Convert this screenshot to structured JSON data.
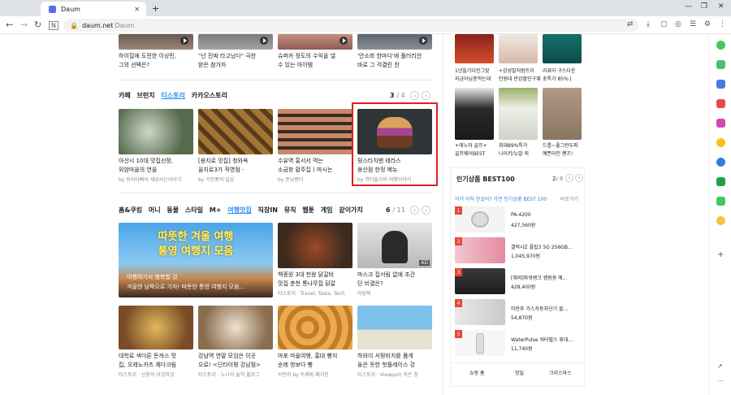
{
  "browser": {
    "tab_title": "Daum",
    "url": "daum.net",
    "url_suffix": "Daum"
  },
  "top_strip": [
    {
      "title": "하이힐에 도전한 이상민,",
      "title2": "그의 선택은?"
    },
    {
      "title": "\"넌 진짜 타고났다\" 극찬",
      "title2": "받은 참가자"
    },
    {
      "title": "슈퍼카 정도의 수익을 낼",
      "title2": "수 있는 아이템"
    },
    {
      "title": "'안소희 한마디'에 플러리안",
      "title2": "바로 그 걱결린 찬"
    }
  ],
  "section1": {
    "tabs": [
      "카페",
      "브런치",
      "티스토리",
      "카카오스토리"
    ],
    "active_tab": "티스토리",
    "page": "3",
    "total": "/ 4",
    "cards": [
      {
        "title": "아산시 10대 맛집선정,",
        "title2": "외암마을의 연을",
        "source": "by 동지아빠의 세상사는이야기"
      },
      {
        "title": "[용지로 맛집] 청와옥",
        "title2": "을지로3가 직영점 -",
        "source": "by 기린뽀의 일상"
      },
      {
        "title": "수유역 홍서서 먹는",
        "title2": "소금창 황주집 ( 마시는",
        "source": "by 준닝랜더"
      },
      {
        "title": "핑스타치맨 테라스",
        "title2": "용산점 한정 메뉴",
        "source": "by 히티들리의 여행이야기"
      }
    ]
  },
  "section2": {
    "tabs": [
      "홈&쿠킹",
      "머니",
      "동물",
      "스타일",
      "M+",
      "여행맛집",
      "직장IN",
      "뮤직",
      "웹툰",
      "게임",
      "같이가치"
    ],
    "active_tab": "여행맛집",
    "page": "6",
    "total": "/ 11",
    "hero": {
      "line1": "따뜻한 겨울 여행",
      "line2": "통영 여행지 모음",
      "caption1": "여행여기서 행복할 것",
      "caption2": "겨울엔 남쪽으로 가자! 따뜻한 통영 여행지 모음..."
    },
    "cards": [
      {
        "title": "백종원 3대 천왕 닭갈비",
        "title2": "맛집 춘천 통나무집 닭갈",
        "source": "티스토리 · Travel, Taste, Tech"
      },
      {
        "title": "마스크 집서림 없애 조간",
        "title2": "단 비결은?",
        "source": "리빙픽",
        "tag": "AD"
      },
      {
        "title": "대학로 색다른 돈까스 맛",
        "title2": "집, 오레노카츠 체다크림",
        "source": "티스토리 · 신웅의 이것저것"
      },
      {
        "title": "강남역 연말 모임은 이곳",
        "title2": "으로! <딘타이펑 강남점>",
        "source": "티스토리 · 노나의 술직 블로그"
      },
      {
        "title": "마포 마을여행, 홍대 빵지",
        "title2": "순례 방보다 빵",
        "source": "브런치 by 트레바 매거진"
      },
      {
        "title": "하와이 서핑비치를 품게",
        "title2": "놓은 듯한 핫플레이스 강",
        "source": "티스토리 · Viewport 작은 창"
      }
    ]
  },
  "shopping_top": [
    {
      "title": "1년을기다린그랏",
      "title2": "지금아님못먹는대"
    },
    {
      "title": "+감성발처럼트리",
      "title2": "만원대 반갑할인구혜숍"
    },
    {
      "title": "라퓨아 구스다운",
      "title2": "초특가 85% |"
    },
    {
      "title": "+레노마 골프+",
      "title2": "골프웨어BEST"
    },
    {
      "title": "최대89%특가",
      "title2": "나이키/뉴발 외"
    },
    {
      "title": "드롭~풀그란두퍼",
      "title2": "예쁜라인 팬츠!"
    }
  ],
  "best100": {
    "title": "인기상품 BEST100",
    "page": "2",
    "total": "/ 6",
    "subtitle": "이거 아직 안샀어? 가전 인기상품 BEST 100",
    "more": "바로가기",
    "items": [
      {
        "rank": "1",
        "name": "PA-4200",
        "price": "427,560원"
      },
      {
        "rank": "2",
        "name": "갤럭시Z 플립3 5G 256GB...",
        "price": "1,045,970원"
      },
      {
        "rank": "3",
        "name": "[해외]파워뱅크 캠핑용 에...",
        "price": "428,400원"
      },
      {
        "rank": "4",
        "name": "미란후 가스차동차단기 블...",
        "price": "54,870원"
      },
      {
        "rank": "5",
        "name": "WaterPulse 워터펄스 휴대...",
        "price": "11,740원"
      }
    ],
    "footer_tabs": [
      "쇼핑 홈",
      "핫딜",
      "크리스마스"
    ]
  }
}
